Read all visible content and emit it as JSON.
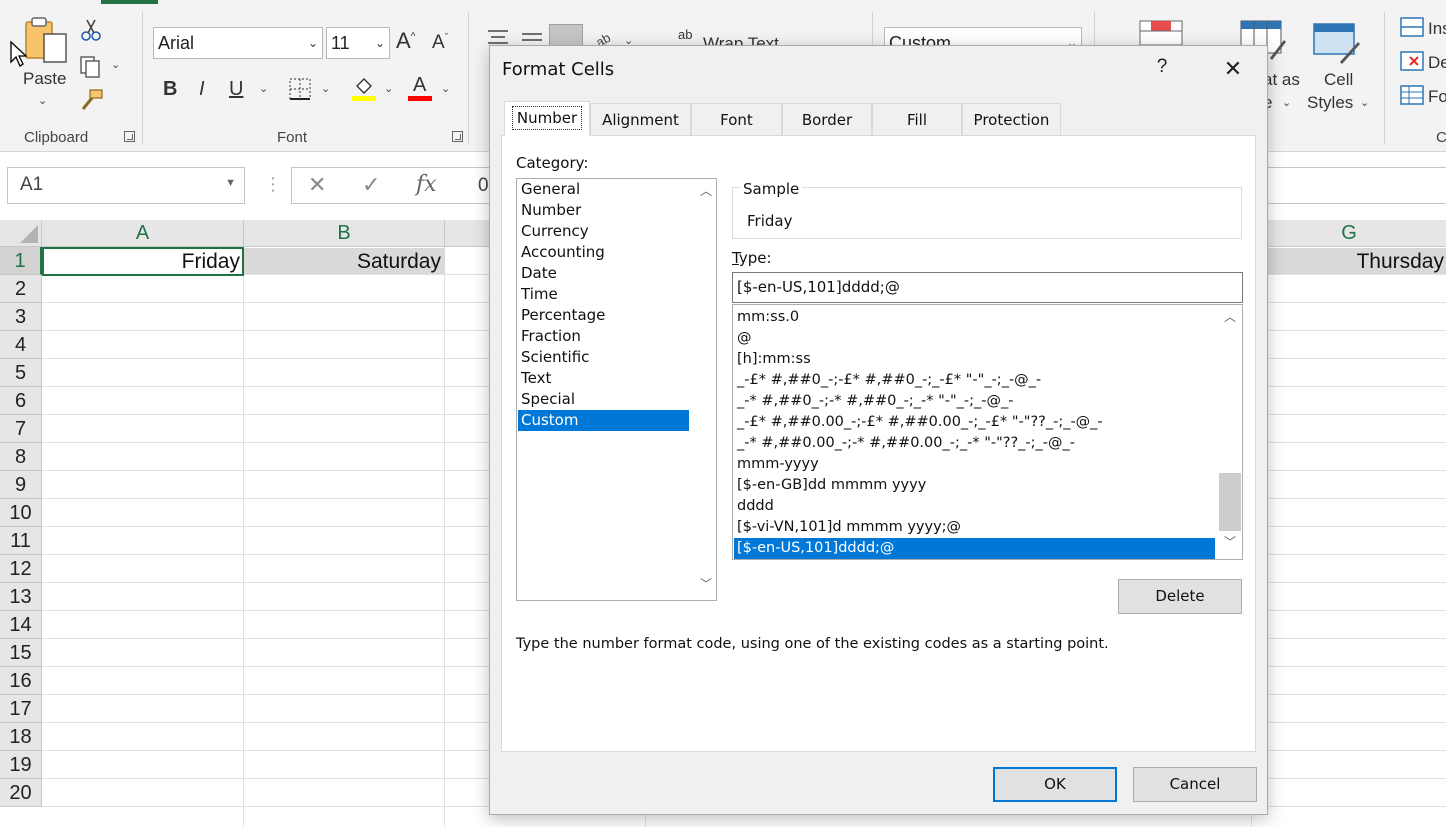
{
  "ribbon": {
    "clipboard": {
      "paste_label": "Paste",
      "group_label": "Clipboard"
    },
    "font": {
      "font_name": "Arial",
      "font_size": "11",
      "increase_size_glyph": "A",
      "decrease_size_glyph": "A",
      "bold_glyph": "B",
      "italic_glyph": "I",
      "underline_glyph": "U",
      "font_color_glyph": "A",
      "group_label": "Font",
      "fill_color": "#ffff00",
      "font_color": "#ff0000"
    },
    "alignment": {
      "wrap_text_label": "Wrap Text",
      "wrap_glyph": "ab"
    },
    "number": {
      "format_value": "Custom"
    },
    "styles": {
      "format_as_table_partial": "at as",
      "format_as_table_line2": "e",
      "cell_styles_line1": "Cell",
      "cell_styles_line2": "Styles"
    },
    "cells": {
      "insert_partial": "Ins",
      "delete_partial": "De",
      "format_partial": "Fo",
      "group_partial": "C"
    }
  },
  "formula_bar": {
    "name_box": "A1",
    "formula_partial": "0",
    "fx_label": "fx"
  },
  "sheet": {
    "columns": [
      "A",
      "B",
      "G"
    ],
    "rows": [
      "1",
      "2",
      "3",
      "4",
      "5",
      "6",
      "7",
      "8",
      "9",
      "10",
      "11",
      "12",
      "13",
      "14",
      "15",
      "16",
      "17",
      "18",
      "19",
      "20"
    ],
    "cells": {
      "A1": "Friday",
      "B1": "Saturday",
      "G1": "Thursday"
    }
  },
  "dialog": {
    "title": "Format Cells",
    "help_glyph": "?",
    "close_glyph": "✕",
    "tabs": [
      "Number",
      "Alignment",
      "Font",
      "Border",
      "Fill",
      "Protection"
    ],
    "active_tab": "Number",
    "category_label": "Category:",
    "categories": [
      "General",
      "Number",
      "Currency",
      "Accounting",
      "Date",
      "Time",
      "Percentage",
      "Fraction",
      "Scientific",
      "Text",
      "Special",
      "Custom"
    ],
    "selected_category": "Custom",
    "sample_label": "Sample",
    "sample_value": "Friday",
    "type_label": "Type:",
    "type_value": "[$-en-US,101]dddd;@",
    "format_codes": [
      "mm:ss.0",
      "@",
      "[h]:mm:ss",
      "_-£* #,##0_-;-£* #,##0_-;_-£* \"-\"_-;_-@_-",
      "_-* #,##0_-;-* #,##0_-;_-* \"-\"_-;_-@_-",
      "_-£* #,##0.00_-;-£* #,##0.00_-;_-£* \"-\"??_-;_-@_-",
      "_-* #,##0.00_-;-* #,##0.00_-;_-* \"-\"??_-;_-@_-",
      "mmm-yyyy",
      "[$-en-GB]dd mmmm yyyy",
      "dddd",
      "[$-vi-VN,101]d mmmm yyyy;@",
      "[$-en-US,101]dddd;@"
    ],
    "selected_code": "[$-en-US,101]dddd;@",
    "delete_label": "Delete",
    "hint": "Type the number format code, using one of the existing codes as a starting point.",
    "ok_label": "OK",
    "cancel_label": "Cancel",
    "accent_color": "#0078d7"
  }
}
